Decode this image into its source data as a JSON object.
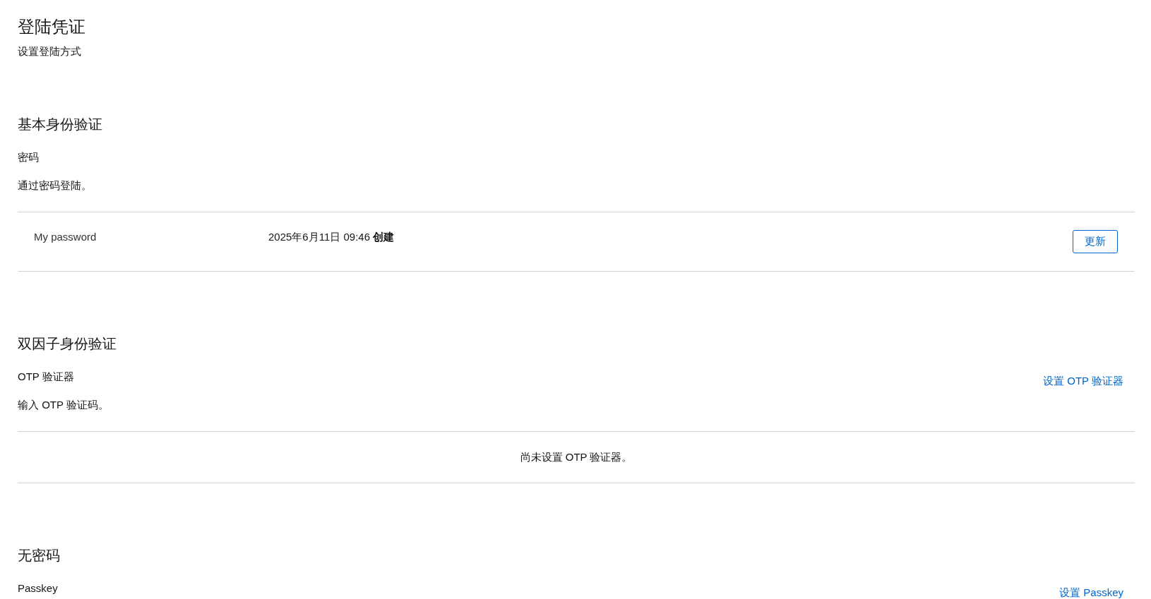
{
  "page": {
    "title": "登陆凭证",
    "subtitle": "设置登陆方式"
  },
  "sections": [
    {
      "title": "基本身份验证",
      "types": [
        {
          "title": "密码",
          "description": "通过密码登陆。",
          "credentials": [
            {
              "label": "My password",
              "created": "2025年6月11日 09:46 **创建**",
              "button": "更新"
            }
          ]
        }
      ]
    },
    {
      "title": "双因子身份验证",
      "types": [
        {
          "title": "OTP 验证器",
          "description": "输入 OTP 验证码。",
          "link": "设置 OTP 验证器",
          "empty": "尚未设置 OTP 验证器。"
        }
      ]
    },
    {
      "title": "无密码",
      "types": [
        {
          "title": "Passkey",
          "link": "设置 Passkey"
        }
      ]
    }
  ]
}
